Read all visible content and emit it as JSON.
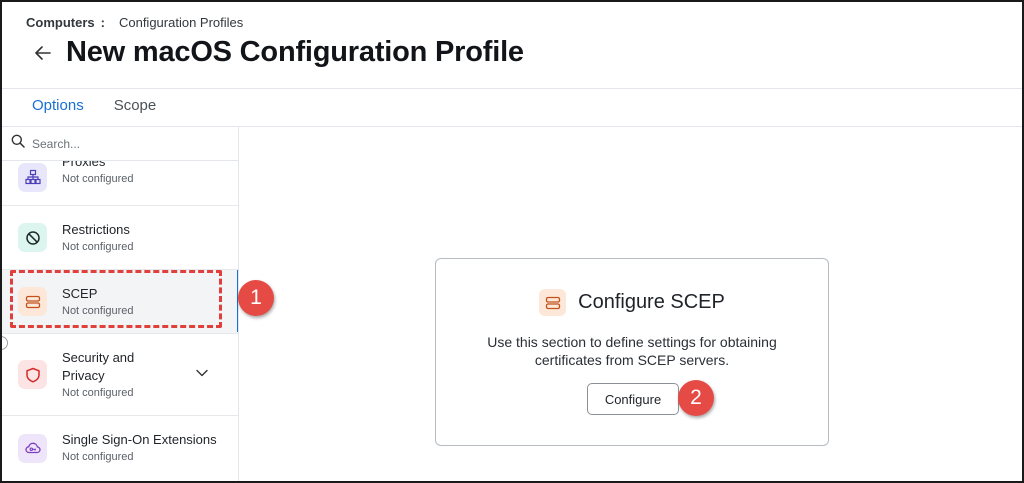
{
  "header": {
    "breadcrumb_root": "Computers",
    "breadcrumb_separator": ":",
    "breadcrumb_current": "Configuration Profiles",
    "title": "New macOS Configuration Profile"
  },
  "tabs": [
    {
      "label": "Options",
      "active": true
    },
    {
      "label": "Scope",
      "active": false
    }
  ],
  "search": {
    "placeholder": "Search..."
  },
  "sidebar": {
    "items": [
      {
        "label": "Proxies",
        "status": "Not configured",
        "icon": "network-hierarchy-icon"
      },
      {
        "label": "Restrictions",
        "status": "Not configured",
        "icon": "no-entry-icon"
      },
      {
        "label": "SCEP",
        "status": "Not configured",
        "icon": "server-stack-icon",
        "selected": true
      },
      {
        "label": "Security and Privacy",
        "status": "Not configured",
        "icon": "shield-icon"
      },
      {
        "label": "Single Sign-On Extensions",
        "status": "Not configured",
        "icon": "cloud-key-icon"
      }
    ]
  },
  "main": {
    "card_title": "Configure SCEP",
    "card_description": "Use this section to define settings for obtaining certificates from SCEP servers.",
    "configure_label": "Configure"
  },
  "annotations": {
    "badge_1": "1",
    "badge_2": "2"
  },
  "colors": {
    "accent": "#1a6fd6",
    "annotation": "#e0403b",
    "proxies_icon_bg": "#e8e6fb",
    "restrictions_icon_bg": "#ddf5ef",
    "scep_icon_bg": "#fde7d8",
    "security_icon_bg": "#fde4e4",
    "sso_icon_bg": "#efe5fb"
  }
}
